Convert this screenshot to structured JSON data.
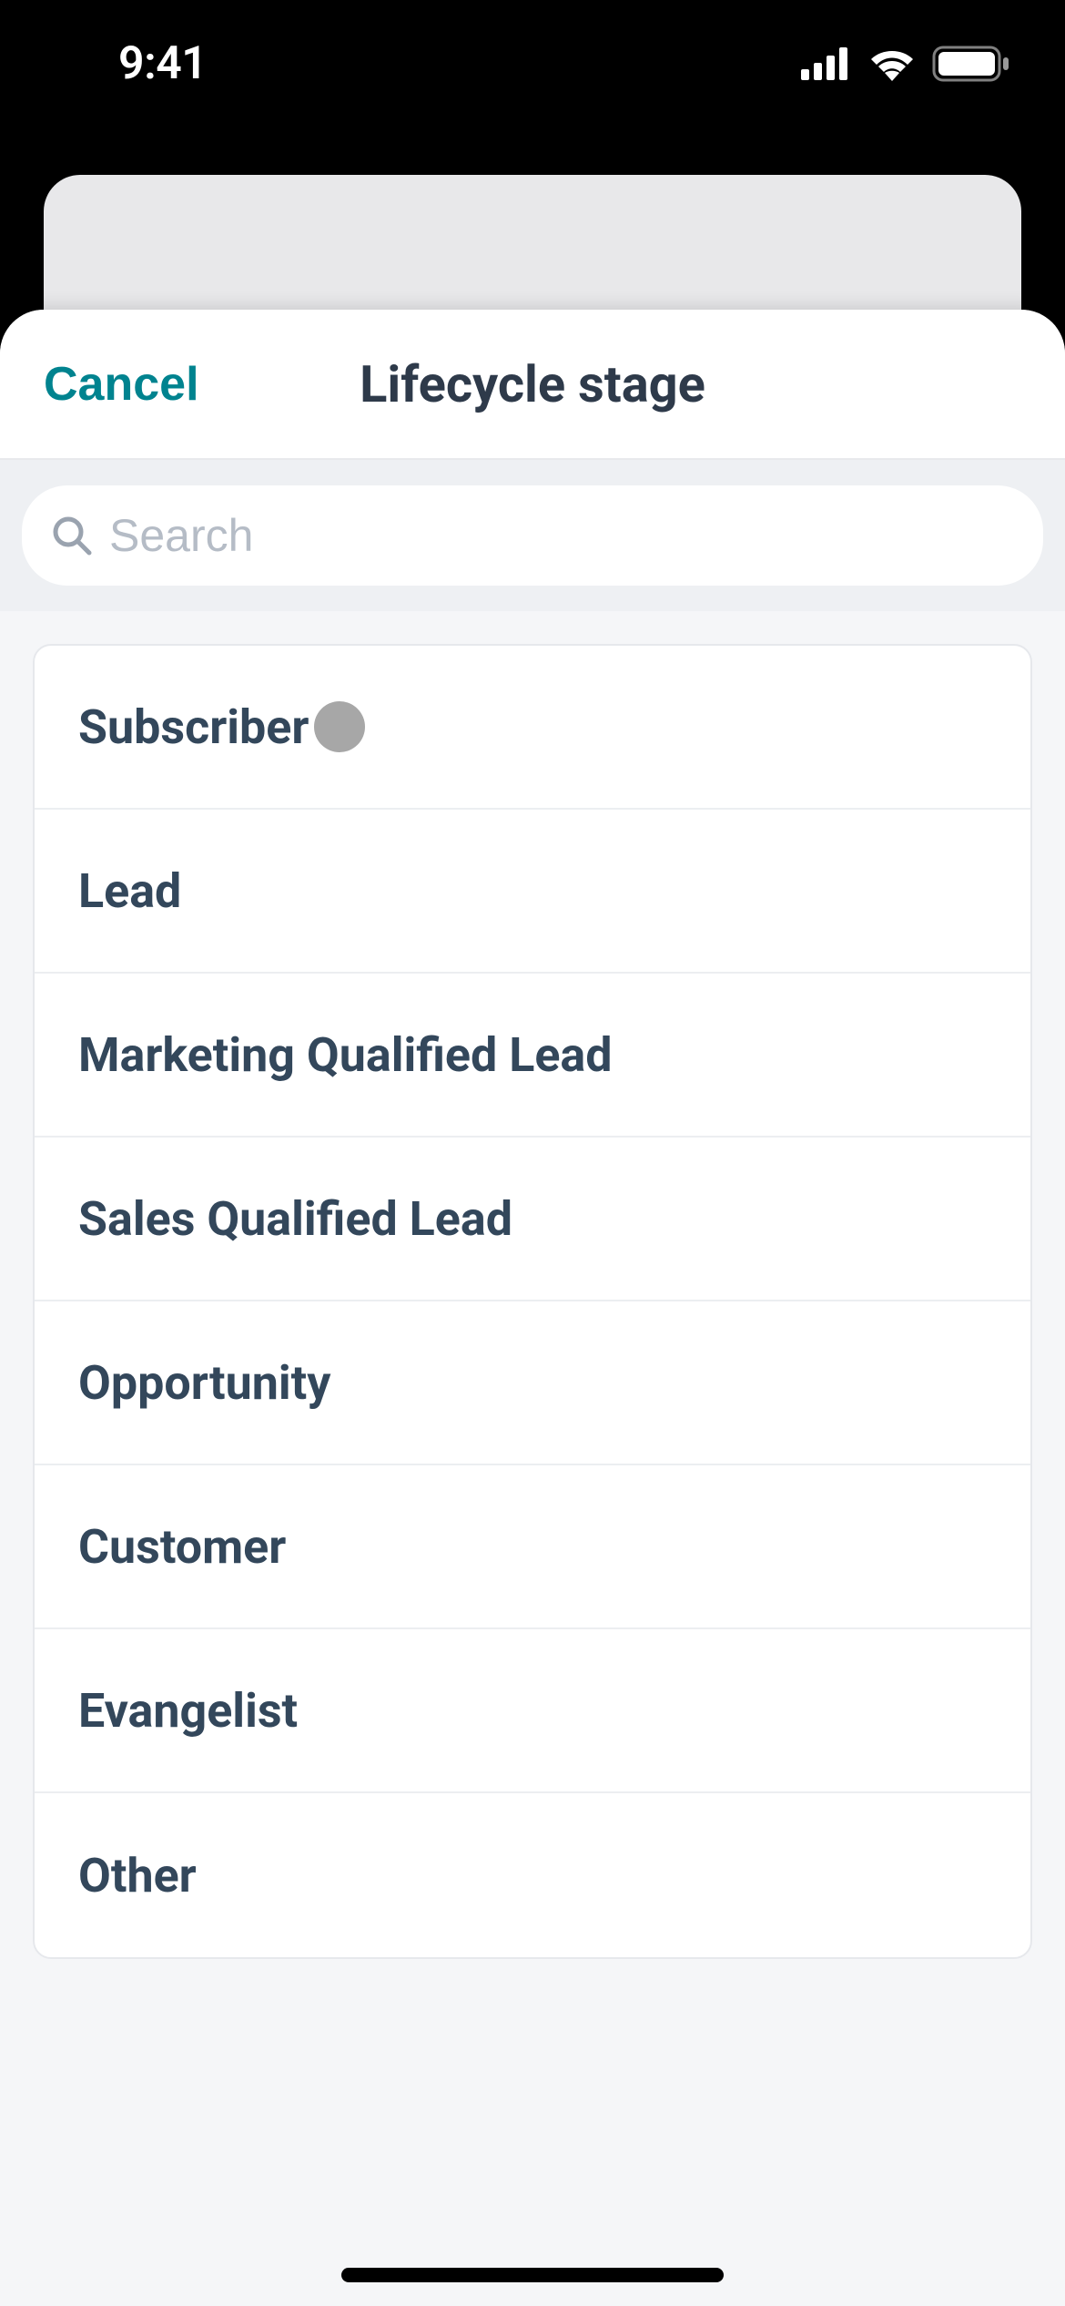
{
  "status": {
    "time": "9:41"
  },
  "modal": {
    "cancel_label": "Cancel",
    "title": "Lifecycle stage"
  },
  "search": {
    "placeholder": "Search"
  },
  "options": [
    {
      "label": "Subscriber",
      "has_dot": true
    },
    {
      "label": "Lead",
      "has_dot": false
    },
    {
      "label": "Marketing Qualified Lead",
      "has_dot": false
    },
    {
      "label": "Sales Qualified Lead",
      "has_dot": false
    },
    {
      "label": "Opportunity",
      "has_dot": false
    },
    {
      "label": "Customer",
      "has_dot": false
    },
    {
      "label": "Evangelist",
      "has_dot": false
    },
    {
      "label": "Other",
      "has_dot": false
    }
  ]
}
